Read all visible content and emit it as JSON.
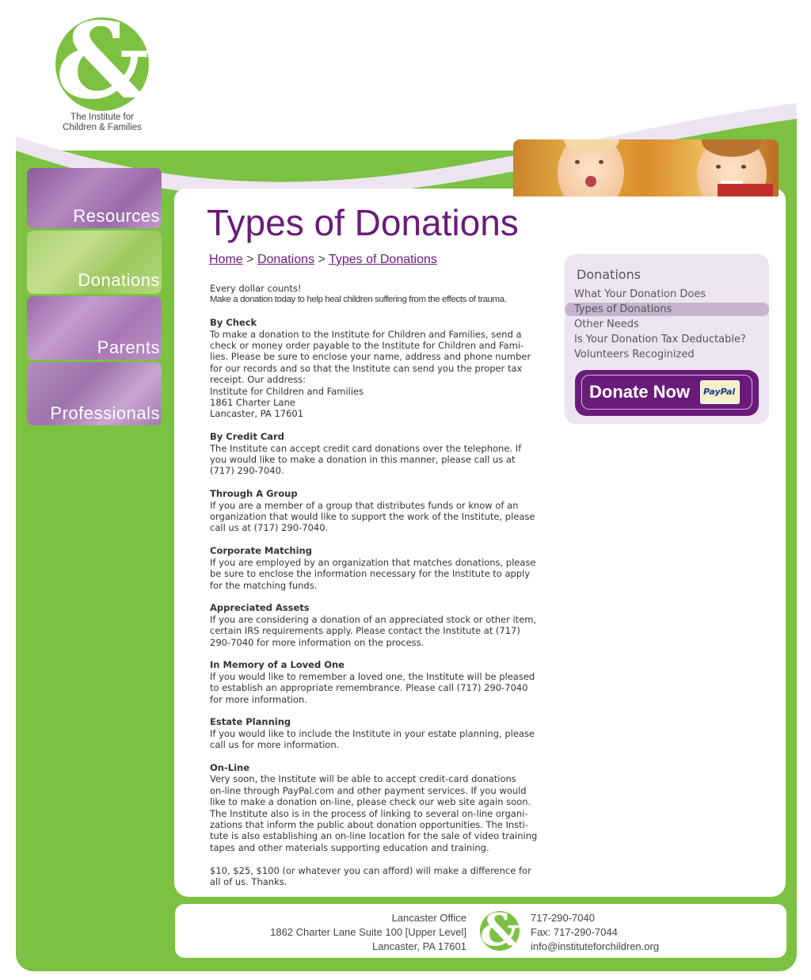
{
  "logo": {
    "line1": "The Institute for",
    "line2": "Children & Families",
    "glyph": "&"
  },
  "nav": {
    "resources": "Resources",
    "donations": "Donations",
    "parents": "Parents",
    "professionals": "Professionals"
  },
  "page_title": "Types of Donations",
  "breadcrumb": {
    "home": "Home",
    "sep": ">",
    "donations": "Donations",
    "current": "Types of Donations"
  },
  "content": {
    "intro1": "Every dollar counts!",
    "intro2": "Make a donation today to help heal children suffering from the effects of trauma.",
    "check": {
      "heading": "By Check",
      "lines": [
        "To make a donation to the Institute for Children and Families, send a",
        "check or money order payable to the Institute for Children and Fami-",
        "lies. Please be sure to enclose your name, address and phone number",
        "for our records and so that the Institute can send you the proper tax",
        "receipt. Our address:",
        "Institute for Children and Families",
        "1861 Charter Lane",
        "Lancaster, PA 17601"
      ]
    },
    "credit": {
      "heading": "By Credit Card",
      "lines": [
        "The Institute can accept credit card donations over the telephone. If",
        "you would like to make a donation in this manner, please call us at",
        "(717) 290-7040."
      ]
    },
    "group": {
      "heading": "Through A Group",
      "lines": [
        "If you are a member of a group that distributes funds or know of an",
        "organization that would like to support the work of the Institute, please",
        "call us at (717) 290-7040."
      ]
    },
    "corporate": {
      "heading": "Corporate Matching",
      "lines": [
        "If you are employed by an organization that matches donations, please",
        "be sure to enclose the information necessary for the Institute to apply",
        "for the matching funds."
      ]
    },
    "assets": {
      "heading": "Appreciated Assets",
      "lines": [
        "If you are considering a donation of an appreciated stock or other item,",
        "certain IRS requirements apply. Please contact the Institute at (717)",
        "290-7040 for more information on the process."
      ]
    },
    "memory": {
      "heading": "In Memory of a Loved One",
      "lines": [
        "If you would like to remember a loved one, the Institute will be pleased",
        "to establish an appropriate remembrance. Please call (717) 290-7040",
        "for more information."
      ]
    },
    "estate": {
      "heading": "Estate Planning",
      "lines": [
        "If you would like to include the Institute in your estate planning, please",
        "call us for more information."
      ]
    },
    "online": {
      "heading": "On-Line",
      "lines": [
        "Very soon, the Institute will be able to accept credit-card donations",
        "on-line through PayPal.com and other payment services. If you would",
        "like to make a donation on-line, please check our web site again soon.",
        "The Institute also is in the process of linking to several on-line organi-",
        "zations that inform the public about donation opportunities. The Insti-",
        "tute is also establishing an on-line location for the sale of video training",
        "tapes and other materials supporting education and training."
      ]
    },
    "closing": [
      "$10, $25, $100 (or whatever you can afford) will make a difference for",
      "all of us. Thanks."
    ]
  },
  "sidebar": {
    "title": "Donations",
    "items": [
      {
        "label": "What Your Donation Does"
      },
      {
        "label": "Types of Donations",
        "active": true
      },
      {
        "label": "Other Needs"
      },
      {
        "label": "Is Your Donation Tax Deductable?"
      },
      {
        "label": "Volunteers Recoginized"
      }
    ],
    "donate_label": "Donate Now",
    "paypal_label": "PayPal"
  },
  "footer": {
    "office": "Lancaster Office",
    "address": "1862 Charter Lane Suite 100 [Upper Level]",
    "city": "Lancaster, PA 17601",
    "phone": "717-290-7040",
    "fax": "Fax: 717-290-7044",
    "email": "info@instituteforchildren.org"
  },
  "colors": {
    "green": "#7cc142",
    "purple": "#6a1b7a",
    "lavender": "#ece5f1"
  }
}
